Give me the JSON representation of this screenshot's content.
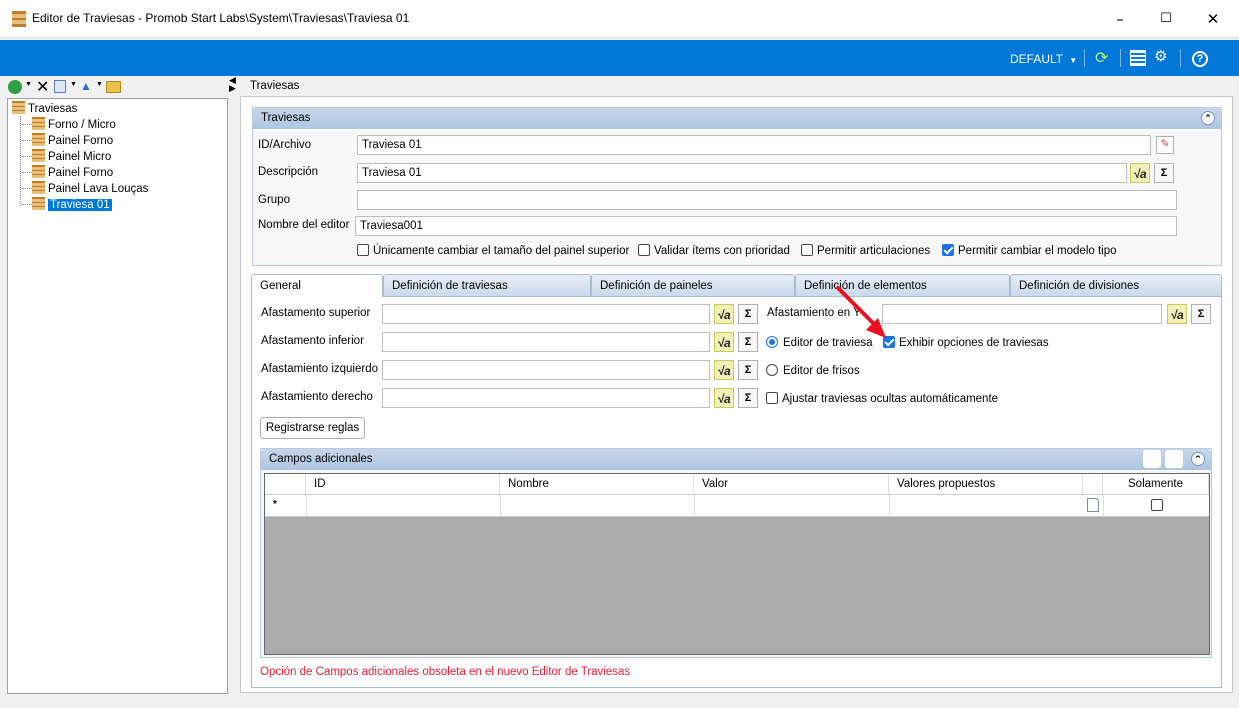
{
  "window": {
    "title": "Editor de Traviesas - Promob Start Labs\\System\\Traviesas\\Traviesa 01",
    "minimize": "–",
    "maximize": "☐",
    "close": "✕"
  },
  "toolbar": {
    "profile": "DEFAULT"
  },
  "tree": {
    "root": "Traviesas",
    "items": [
      "Forno / Micro",
      "Painel Forno",
      "Painel Micro",
      "Painel Forno",
      "Painel Lava Louças",
      "Traviesa 01"
    ],
    "selected": "Traviesa 01"
  },
  "breadcrumb": "Traviesas",
  "group": {
    "title": "Traviesas",
    "id_label": "ID/Archivo",
    "id_value": "Traviesa 01",
    "desc_label": "Descripción",
    "desc_value": "Traviesa 01",
    "group_label": "Grupo",
    "group_value": "",
    "editor_name_label": "Nombre del editor",
    "editor_name_value": "Traviesa001",
    "checks": [
      {
        "label": "Únicamente cambiar el tamaño del painel superior",
        "checked": false
      },
      {
        "label": "Validar ítems con prioridad",
        "checked": false
      },
      {
        "label": "Permitir articulaciones",
        "checked": false
      },
      {
        "label": "Permitir cambiar el modelo tipo",
        "checked": true
      }
    ]
  },
  "tabs": [
    "General",
    "Definición de traviesas",
    "Definición de paineles",
    "Definición de elementos",
    "Definición de divisiones"
  ],
  "general": {
    "fields": [
      "Afastamento superior",
      "Afastamento inferior",
      "Afastamiento izquierdo",
      "Afastamiento derecho"
    ],
    "offset_y_label": "Afastamiento en Y",
    "radio_editor_traviesa": "Editor de traviesa",
    "radio_editor_frisos": "Editor de frisos",
    "check_exhibir": "Exhibir opciones de traviesas",
    "check_ajustar": "Ajustar traviesas ocultas automáticamente",
    "register_button": "Registrarse reglas",
    "formula_symbol": "√a",
    "sigma_symbol": "Σ"
  },
  "campos": {
    "title": "Campos adicionales",
    "columns": [
      "ID",
      "Nombre",
      "Valor",
      "Valores propuestos",
      "Solamente"
    ],
    "new_row_marker": "*",
    "note": "Opción de Campos adicionales obsoleta en el nuevo Editor de Traviesas"
  },
  "colors": {
    "accent": "#0078d7",
    "annotation": "#e8101c",
    "note": "#e0203a"
  }
}
